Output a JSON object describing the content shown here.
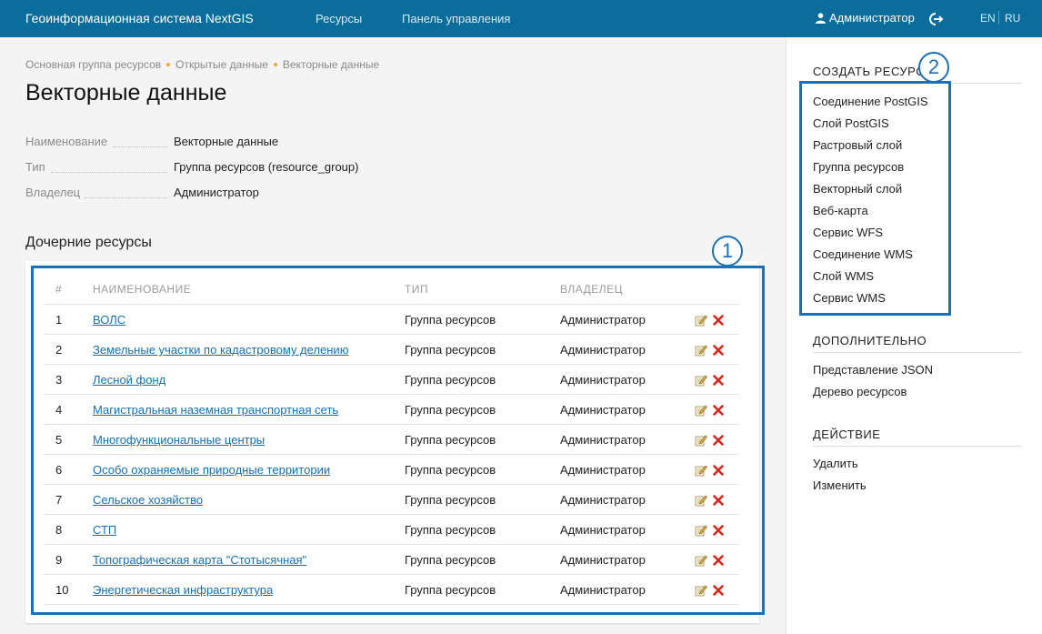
{
  "header": {
    "title": "Геоинформационная система NextGIS",
    "nav": [
      "Ресурсы",
      "Панель управления"
    ],
    "user": "Администратор",
    "lang_en": "EN",
    "lang_ru": "RU"
  },
  "breadcrumb": [
    "Основная группа ресурсов",
    "Открытые данные",
    "Векторные данные"
  ],
  "page_title": "Векторные данные",
  "properties": [
    {
      "key": "Наименование",
      "value": "Векторные данные"
    },
    {
      "key": "Тип",
      "value": "Группа ресурсов (resource_group)"
    },
    {
      "key": "Владелец",
      "value": "Администратор"
    }
  ],
  "children_title": "Дочерние ресурсы",
  "table": {
    "headers": {
      "num": "#",
      "name": "НАИМЕНОВАНИЕ",
      "type": "ТИП",
      "owner": "ВЛАДЕЛЕЦ"
    },
    "rows": [
      {
        "num": "1",
        "name": "ВОЛС",
        "type": "Группа ресурсов",
        "owner": "Администратор"
      },
      {
        "num": "2",
        "name": "Земельные участки по кадастровому делению",
        "type": "Группа ресурсов",
        "owner": "Администратор"
      },
      {
        "num": "3",
        "name": "Лесной фонд",
        "type": "Группа ресурсов",
        "owner": "Администратор"
      },
      {
        "num": "4",
        "name": "Магистральная наземная транспортная сеть",
        "type": "Группа ресурсов",
        "owner": "Администратор"
      },
      {
        "num": "5",
        "name": "Многофункциональные центры",
        "type": "Группа ресурсов",
        "owner": "Администратор"
      },
      {
        "num": "6",
        "name": "Особо охраняемые природные территории",
        "type": "Группа ресурсов",
        "owner": "Администратор"
      },
      {
        "num": "7",
        "name": "Сельское хозяйство",
        "type": "Группа ресурсов",
        "owner": "Администратор"
      },
      {
        "num": "8",
        "name": "СТП",
        "type": "Группа ресурсов",
        "owner": "Администратор"
      },
      {
        "num": "9",
        "name": "Топографическая карта \"Стотысячная\"",
        "type": "Группа ресурсов",
        "owner": "Администратор"
      },
      {
        "num": "10",
        "name": "Энергетическая инфраструктура",
        "type": "Группа ресурсов",
        "owner": "Администратор"
      }
    ]
  },
  "sidebar": {
    "create_title": "СОЗДАТЬ РЕСУРС",
    "create_items": [
      "Соединение PostGIS",
      "Слой PostGIS",
      "Растровый слой",
      "Группа ресурсов",
      "Векторный слой",
      "Веб-карта",
      "Сервис WFS",
      "Соединение WMS",
      "Слой WMS",
      "Сервис WMS"
    ],
    "extra_title": "ДОПОЛНИТЕЛЬНО",
    "extra_items": [
      "Представление JSON",
      "Дерево ресурсов"
    ],
    "action_title": "ДЕЙСТВИЕ",
    "action_items": [
      "Удалить",
      "Изменить"
    ]
  },
  "annotations": {
    "callout_1": "1",
    "callout_2": "2"
  },
  "colors": {
    "header_bg": "#0a6d9c",
    "link": "#1570b5",
    "annotation": "#1f6fb5",
    "breadcrumb_dot": "#f0a431",
    "delete_icon": "#d9271d"
  }
}
